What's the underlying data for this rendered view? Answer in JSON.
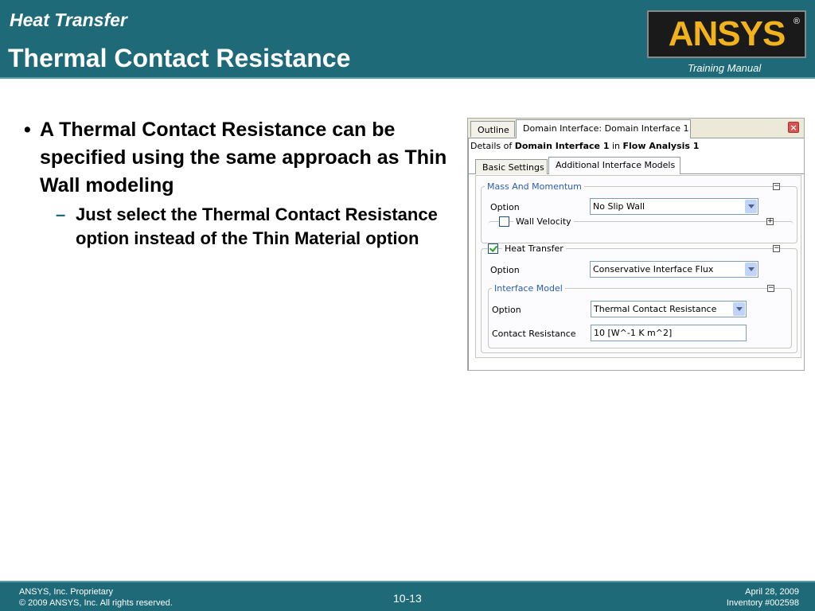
{
  "header": {
    "course": "Heat Transfer",
    "title": "Thermal Contact Resistance",
    "logo_text": "ANSYS",
    "logo_reg": "®",
    "training_manual": "Training Manual"
  },
  "bullets": {
    "main_symbol": "•",
    "main_text": "A Thermal Contact Resistance can be specified using the same approach as Thin Wall modeling",
    "sub_symbol": "–",
    "sub_text": "Just select the Thermal Contact Resistance option instead of the Thin Material option"
  },
  "panel": {
    "tabs": [
      "Outline",
      "Domain Interface: Domain Interface 1"
    ],
    "close_symbol": "×",
    "details": {
      "prefix": "Details of ",
      "object": "Domain Interface 1",
      "middle": " in ",
      "analysis": "Flow Analysis 1"
    },
    "subtabs": [
      "Basic Settings",
      "Additional Interface Models"
    ],
    "mass_momentum": {
      "legend": "Mass And Momentum",
      "toggle": "−",
      "option_label": "Option",
      "option_value": "No Slip Wall",
      "wall_velocity": {
        "label": "Wall Velocity",
        "checked": false,
        "toggle": "+"
      }
    },
    "heat_transfer": {
      "label": "Heat Transfer",
      "checked": true,
      "toggle": "−",
      "option_label": "Option",
      "option_value": "Conservative Interface Flux",
      "interface_model": {
        "legend": "Interface Model",
        "toggle": "−",
        "option_label": "Option",
        "option_value": "Thermal Contact Resistance",
        "contact_resistance_label": "Contact Resistance",
        "contact_resistance_value": "10 [W^-1 K m^2]"
      }
    }
  },
  "footer": {
    "left_line1": "ANSYS, Inc. Proprietary",
    "left_line2": "© 2009 ANSYS, Inc.  All rights reserved.",
    "page": "10-13",
    "right_line1": "April 28, 2009",
    "right_line2": "Inventory #002598"
  },
  "colors": {
    "brand_teal": "#1e6a78",
    "logo_yellow": "#f2b21b",
    "group_title_blue": "#2a5db0"
  }
}
